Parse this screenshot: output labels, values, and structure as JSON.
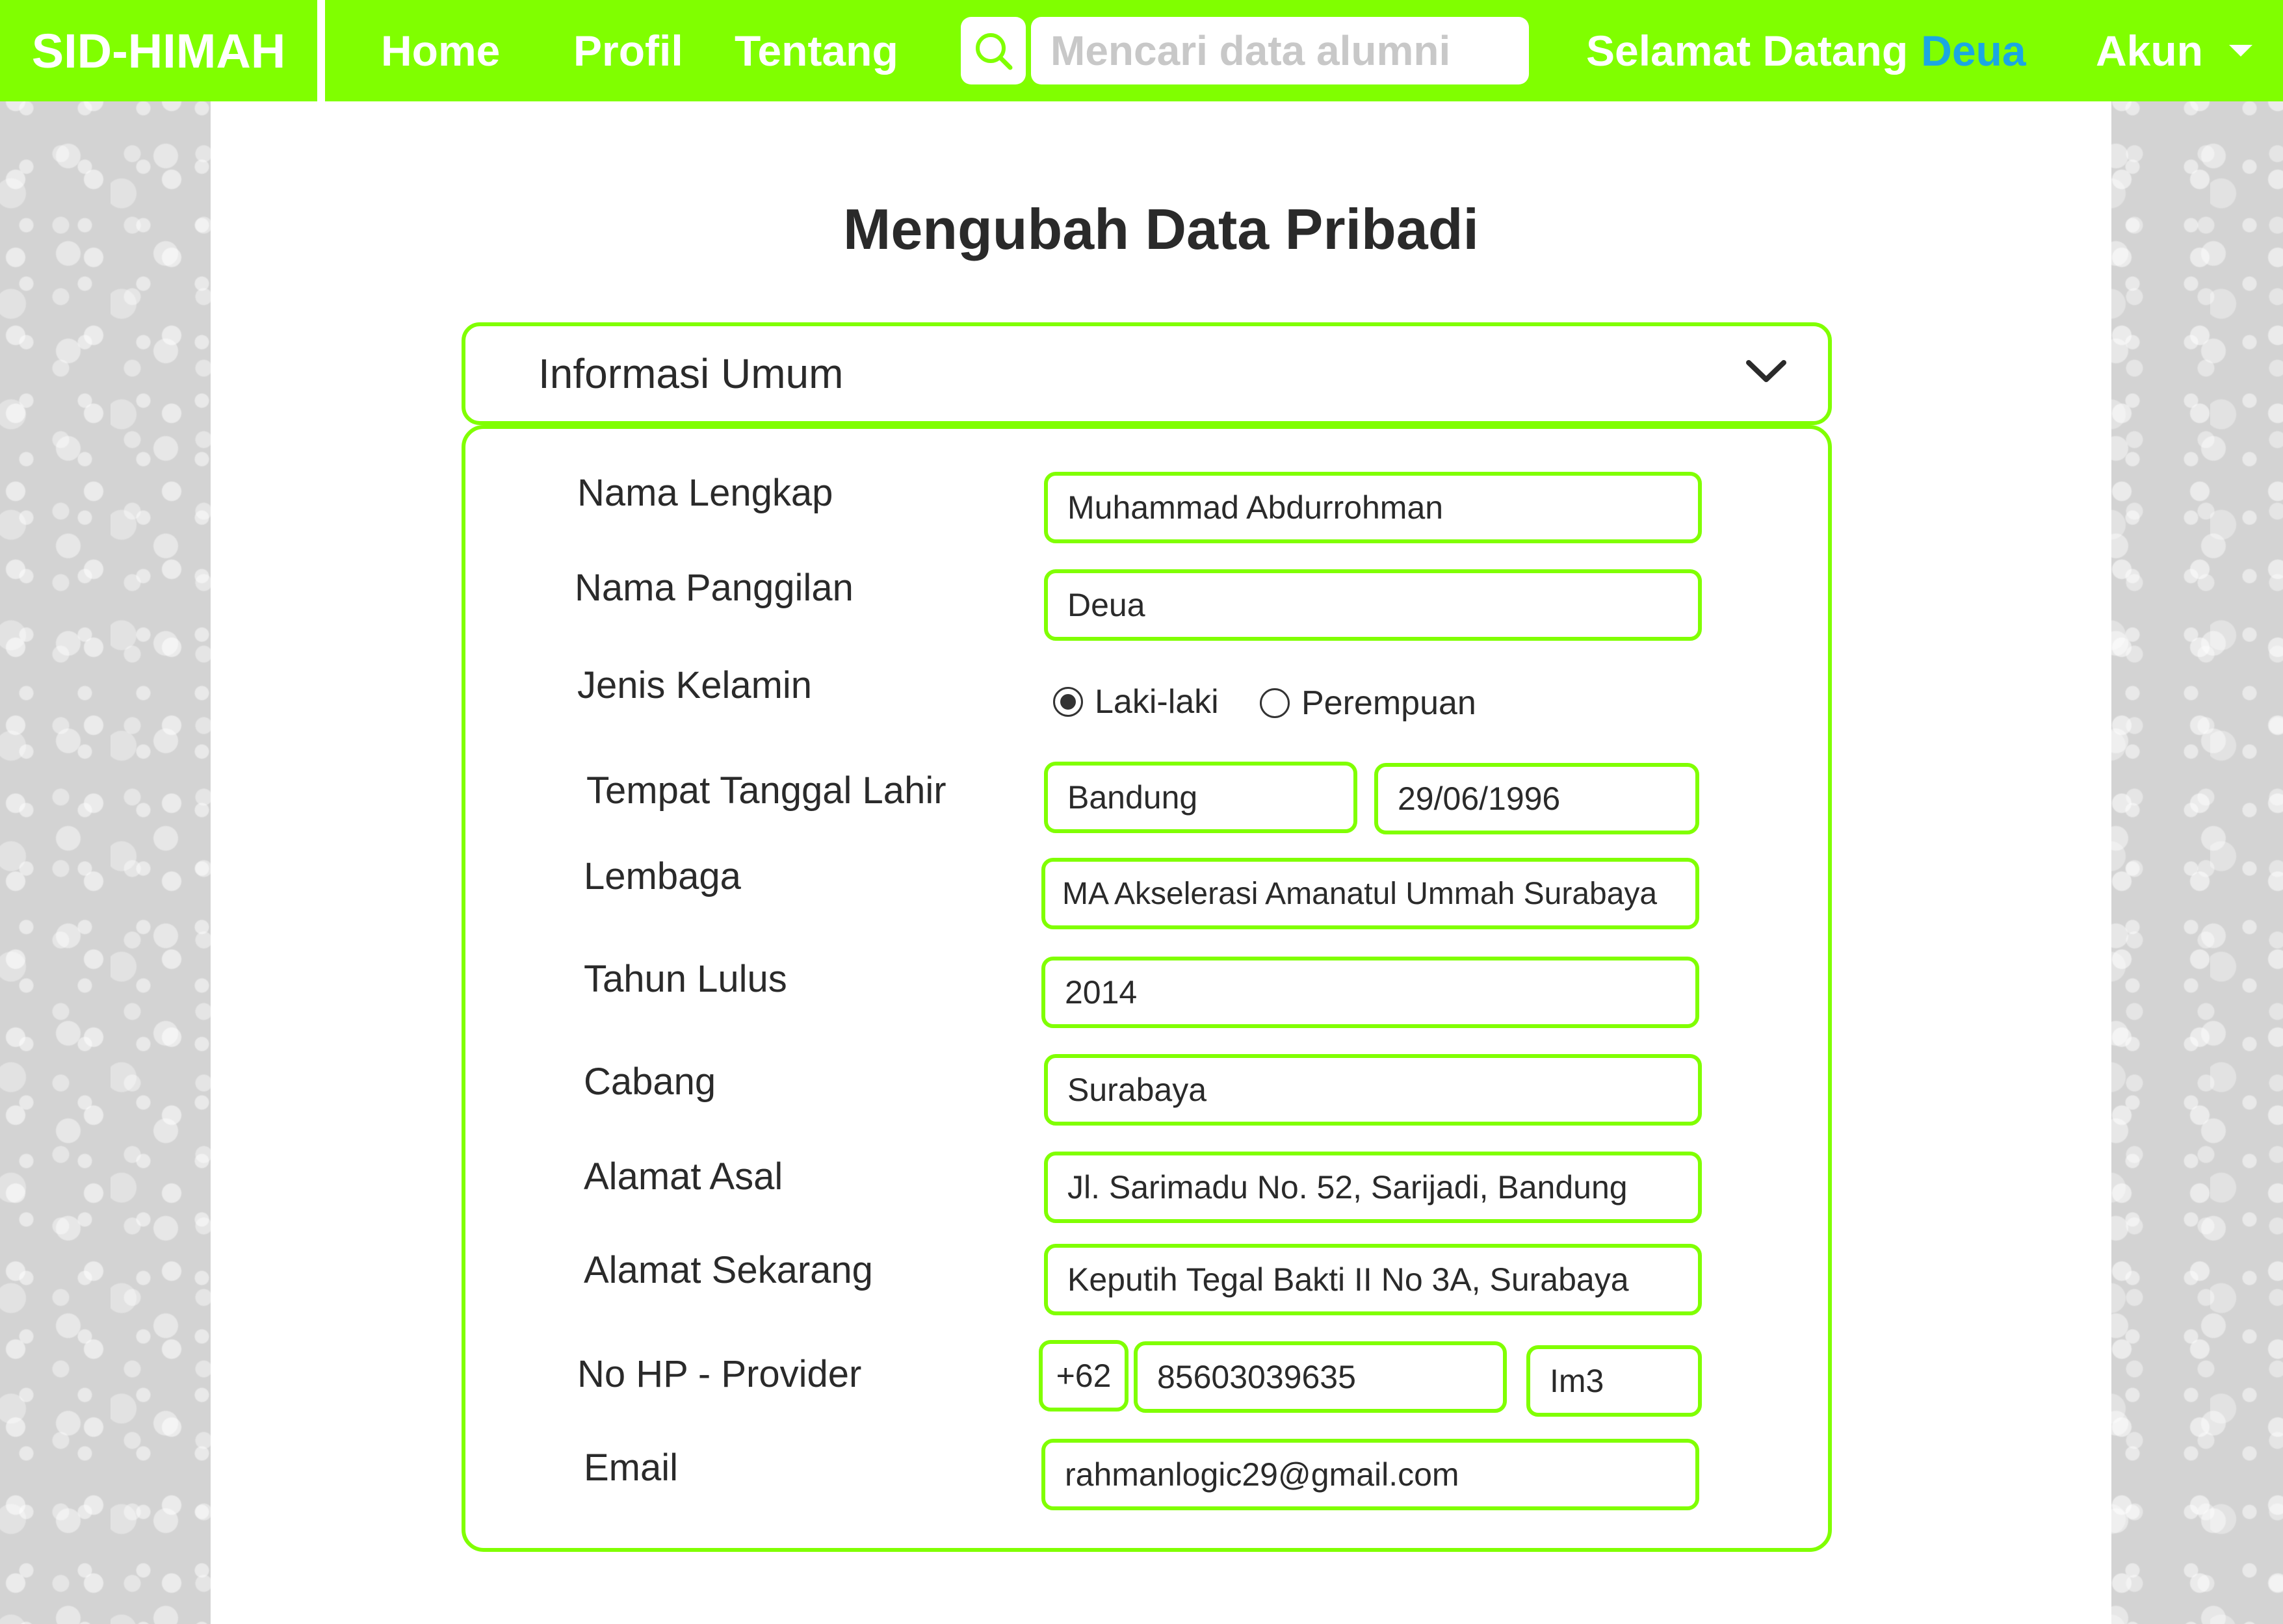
{
  "nav": {
    "brand": "SID-HIMAH",
    "links": [
      "Home",
      "Profil",
      "Tentang"
    ],
    "search_placeholder": "Mencari data alumni",
    "welcome_text": "Selamat Datang",
    "username": "Deua",
    "account_label": "Akun"
  },
  "page": {
    "title": "Mengubah Data Pribadi"
  },
  "section": {
    "title": "Informasi Umum"
  },
  "form": {
    "nama_lengkap": {
      "label": "Nama Lengkap",
      "value": "Muhammad Abdurrohman"
    },
    "nama_panggilan": {
      "label": "Nama Panggilan",
      "value": "Deua"
    },
    "jenis_kelamin": {
      "label": "Jenis Kelamin",
      "options": [
        "Laki-laki",
        "Perempuan"
      ],
      "selected": "Laki-laki"
    },
    "ttl": {
      "label": "Tempat Tanggal Lahir",
      "tempat": "Bandung",
      "tanggal": "29/06/1996"
    },
    "lembaga": {
      "label": "Lembaga",
      "value": "MA Akselerasi Amanatul Ummah Surabaya"
    },
    "tahun_lulus": {
      "label": "Tahun Lulus",
      "value": "2014"
    },
    "cabang": {
      "label": "Cabang",
      "value": "Surabaya"
    },
    "alamat_asal": {
      "label": "Alamat Asal",
      "value": "Jl. Sarimadu No. 52, Sarijadi, Bandung"
    },
    "alamat_sekarang": {
      "label": "Alamat Sekarang",
      "value": "Keputih Tegal Bakti II No 3A, Surabaya"
    },
    "no_hp": {
      "label": "No HP - Provider",
      "prefix": "+62",
      "number": "85603039635",
      "provider": "Im3"
    },
    "email": {
      "label": "Email",
      "value": "rahmanlogic29@gmail.com"
    }
  },
  "colors": {
    "accent": "#80ff00",
    "username": "#1ba7e3",
    "text": "#2a2a2a"
  }
}
